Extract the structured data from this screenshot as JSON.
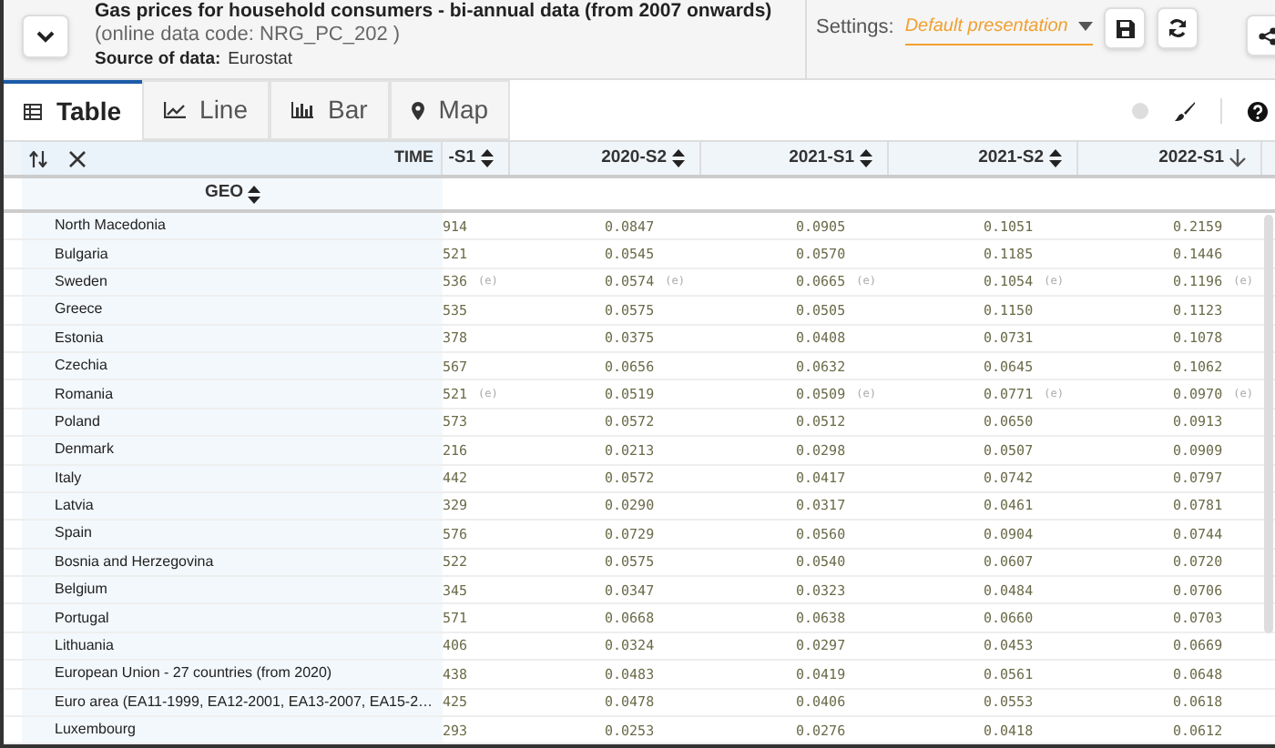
{
  "header": {
    "title": "Gas prices for household consumers - bi-annual data (from 2007 onwards)",
    "code": "(online data code: NRG_PC_202 )",
    "source_label": "Source of data:",
    "source": "Eurostat",
    "settings_label": "Settings:",
    "presentation": "Default presentation"
  },
  "tabs": [
    {
      "label": "Table",
      "selected": true
    },
    {
      "label": "Line",
      "selected": false
    },
    {
      "label": "Bar",
      "selected": false
    },
    {
      "label": "Map",
      "selected": false
    }
  ],
  "table": {
    "time_label": "TIME",
    "geo_label": "GEO",
    "columns": [
      {
        "label": "-S1",
        "sorted": false
      },
      {
        "label": "2020-S2",
        "sorted": false
      },
      {
        "label": "2021-S1",
        "sorted": false
      },
      {
        "label": "2021-S2",
        "sorted": false
      },
      {
        "label": "2022-S1",
        "sorted": true
      }
    ],
    "rows": [
      {
        "geo": "North Macedonia",
        "cells": [
          {
            "value": "914"
          },
          {
            "value": "0.0847"
          },
          {
            "value": "0.0905"
          },
          {
            "value": "0.1051"
          },
          {
            "value": "0.2159"
          }
        ]
      },
      {
        "geo": "Bulgaria",
        "cells": [
          {
            "value": "521"
          },
          {
            "value": "0.0545"
          },
          {
            "value": "0.0570"
          },
          {
            "value": "0.1185"
          },
          {
            "value": "0.1446"
          }
        ]
      },
      {
        "geo": "Sweden",
        "cells": [
          {
            "value": "536",
            "flag": "(e)"
          },
          {
            "value": "0.0574",
            "flag": "(e)"
          },
          {
            "value": "0.0665",
            "flag": "(e)"
          },
          {
            "value": "0.1054",
            "flag": "(e)"
          },
          {
            "value": "0.1196",
            "flag": "(e)"
          }
        ]
      },
      {
        "geo": "Greece",
        "cells": [
          {
            "value": "535"
          },
          {
            "value": "0.0575"
          },
          {
            "value": "0.0505"
          },
          {
            "value": "0.1150"
          },
          {
            "value": "0.1123"
          }
        ]
      },
      {
        "geo": "Estonia",
        "cells": [
          {
            "value": "378"
          },
          {
            "value": "0.0375"
          },
          {
            "value": "0.0408"
          },
          {
            "value": "0.0731"
          },
          {
            "value": "0.1078"
          }
        ]
      },
      {
        "geo": "Czechia",
        "cells": [
          {
            "value": "567"
          },
          {
            "value": "0.0656"
          },
          {
            "value": "0.0632"
          },
          {
            "value": "0.0645"
          },
          {
            "value": "0.1062"
          }
        ]
      },
      {
        "geo": "Romania",
        "cells": [
          {
            "value": "521",
            "flag": "(e)"
          },
          {
            "value": "0.0519"
          },
          {
            "value": "0.0509",
            "flag": "(e)"
          },
          {
            "value": "0.0771",
            "flag": "(e)"
          },
          {
            "value": "0.0970",
            "flag": "(e)"
          }
        ]
      },
      {
        "geo": "Poland",
        "cells": [
          {
            "value": "573"
          },
          {
            "value": "0.0572"
          },
          {
            "value": "0.0512"
          },
          {
            "value": "0.0650"
          },
          {
            "value": "0.0913"
          }
        ]
      },
      {
        "geo": "Denmark",
        "cells": [
          {
            "value": "216"
          },
          {
            "value": "0.0213"
          },
          {
            "value": "0.0298"
          },
          {
            "value": "0.0507"
          },
          {
            "value": "0.0909"
          }
        ]
      },
      {
        "geo": "Italy",
        "cells": [
          {
            "value": "442"
          },
          {
            "value": "0.0572"
          },
          {
            "value": "0.0417"
          },
          {
            "value": "0.0742"
          },
          {
            "value": "0.0797"
          }
        ]
      },
      {
        "geo": "Latvia",
        "cells": [
          {
            "value": "329"
          },
          {
            "value": "0.0290"
          },
          {
            "value": "0.0317"
          },
          {
            "value": "0.0461"
          },
          {
            "value": "0.0781"
          }
        ]
      },
      {
        "geo": "Spain",
        "cells": [
          {
            "value": "576"
          },
          {
            "value": "0.0729"
          },
          {
            "value": "0.0560"
          },
          {
            "value": "0.0904"
          },
          {
            "value": "0.0744"
          }
        ]
      },
      {
        "geo": "Bosnia and Herzegovina",
        "cells": [
          {
            "value": "522"
          },
          {
            "value": "0.0575"
          },
          {
            "value": "0.0540"
          },
          {
            "value": "0.0607"
          },
          {
            "value": "0.0720"
          }
        ]
      },
      {
        "geo": "Belgium",
        "cells": [
          {
            "value": "345"
          },
          {
            "value": "0.0347"
          },
          {
            "value": "0.0323"
          },
          {
            "value": "0.0484"
          },
          {
            "value": "0.0706"
          }
        ]
      },
      {
        "geo": "Portugal",
        "cells": [
          {
            "value": "571"
          },
          {
            "value": "0.0668"
          },
          {
            "value": "0.0638"
          },
          {
            "value": "0.0660"
          },
          {
            "value": "0.0703"
          }
        ]
      },
      {
        "geo": "Lithuania",
        "cells": [
          {
            "value": "406"
          },
          {
            "value": "0.0324"
          },
          {
            "value": "0.0297"
          },
          {
            "value": "0.0453"
          },
          {
            "value": "0.0669"
          }
        ]
      },
      {
        "geo": "European Union - 27 countries (from 2020)",
        "cells": [
          {
            "value": "438"
          },
          {
            "value": "0.0483"
          },
          {
            "value": "0.0419"
          },
          {
            "value": "0.0561"
          },
          {
            "value": "0.0648"
          }
        ]
      },
      {
        "geo": "Euro area (EA11-1999, EA12-2001, EA13-2007, EA15-2…",
        "cells": [
          {
            "value": "425"
          },
          {
            "value": "0.0478"
          },
          {
            "value": "0.0406"
          },
          {
            "value": "0.0553"
          },
          {
            "value": "0.0618"
          }
        ]
      },
      {
        "geo": "Luxembourg",
        "cells": [
          {
            "value": "293"
          },
          {
            "value": "0.0253"
          },
          {
            "value": "0.0276"
          },
          {
            "value": "0.0418"
          },
          {
            "value": "0.0612"
          }
        ]
      }
    ]
  }
}
